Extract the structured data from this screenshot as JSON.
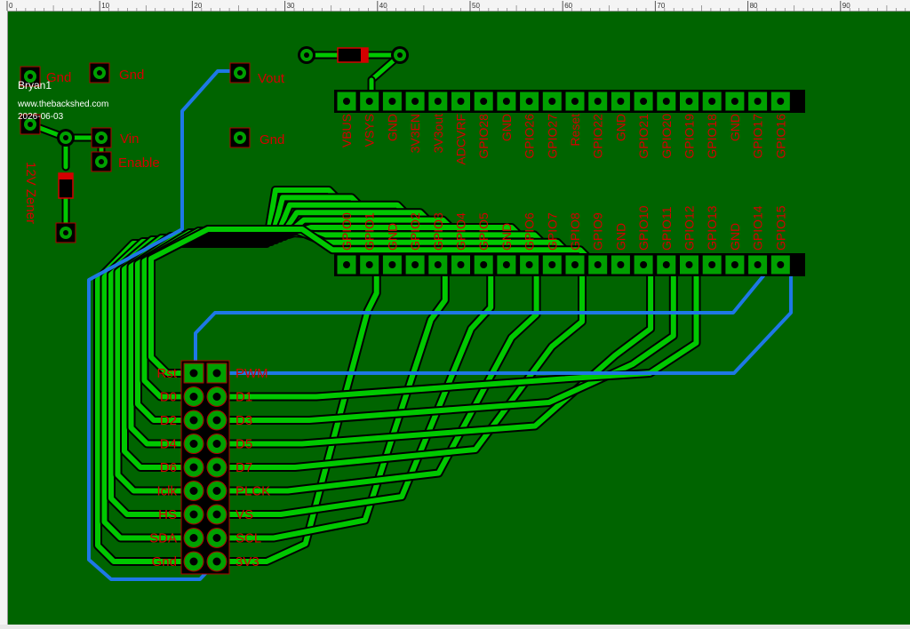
{
  "ruler": {
    "top_marks": [
      "0",
      "10",
      "20",
      "30",
      "40",
      "50",
      "60",
      "70",
      "80",
      "90"
    ]
  },
  "watermark": {
    "name": "Bryan1",
    "site": "www.thebackshed.com",
    "date": "2026-06-03"
  },
  "labels": {
    "gnd1": "Gnd",
    "gnd2": "Gnd",
    "vin": "Vin",
    "enable": "Enable",
    "zener": "12V Zener",
    "vout": "Vout",
    "gnd3": "Gnd"
  },
  "pico": {
    "top_pins": [
      "VBUS",
      "VSYS",
      "GND",
      "3V3EN",
      "3V3out",
      "ADCVRF",
      "GPIO28",
      "GND",
      "GPIO26",
      "GPIO27",
      "Reset",
      "GPIO22",
      "GND",
      "GPIO21",
      "GPIO20",
      "GPIO19",
      "GPIO18",
      "GND",
      "GPIO17",
      "GPIO16"
    ],
    "bottom_pins": [
      "GPIO0",
      "GPIO1",
      "GND",
      "GPIO2",
      "GPIO3",
      "GPIO4",
      "GPIO5",
      "GND",
      "GPIO6",
      "GPIO7",
      "GPIO8",
      "GPIO9",
      "GND",
      "GPIO10",
      "GPIO11",
      "GPIO12",
      "GPIO13",
      "GND",
      "GPIO14",
      "GPIO15"
    ]
  },
  "header": {
    "left": [
      "Rst",
      "D0",
      "D2",
      "D4",
      "D6",
      "Iclk",
      "HS",
      "SDA",
      "Gnd"
    ],
    "right": [
      "PWM",
      "D1",
      "D3",
      "D5",
      "D7",
      "PLCK",
      "VS",
      "SCL",
      "3V3"
    ]
  },
  "colors": {
    "board": "#006400",
    "trace": "#00c800",
    "jumper": "#1e78e6",
    "pad": "#00a000",
    "outline": "#000000",
    "silk": "#d40000"
  }
}
